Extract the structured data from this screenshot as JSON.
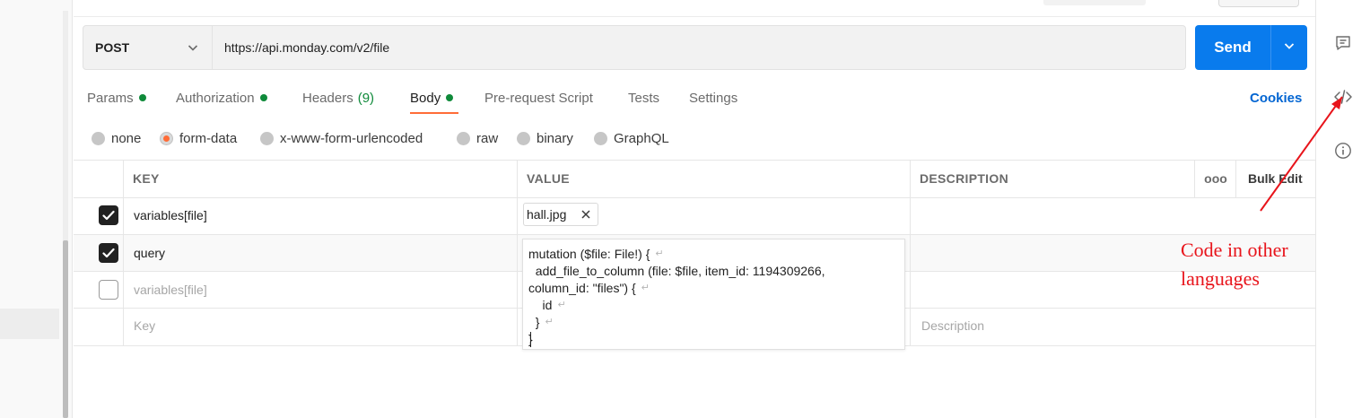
{
  "request": {
    "method": "POST",
    "url": "https://api.monday.com/v2/file",
    "send_label": "Send"
  },
  "tabs": [
    {
      "label": "Params",
      "dot": true
    },
    {
      "label": "Authorization",
      "dot": true
    },
    {
      "label": "Headers",
      "count": "(9)"
    },
    {
      "label": "Body",
      "dot": true,
      "active": true
    },
    {
      "label": "Pre-request Script"
    },
    {
      "label": "Tests"
    },
    {
      "label": "Settings"
    }
  ],
  "cookies_label": "Cookies",
  "body_types": [
    {
      "label": "none",
      "selected": false
    },
    {
      "label": "form-data",
      "selected": true
    },
    {
      "label": "x-www-form-urlencoded",
      "selected": false
    },
    {
      "label": "raw",
      "selected": false
    },
    {
      "label": "binary",
      "selected": false
    },
    {
      "label": "GraphQL",
      "selected": false
    }
  ],
  "table": {
    "headers": {
      "key": "KEY",
      "value": "VALUE",
      "description": "DESCRIPTION",
      "more": "ooo",
      "bulk_edit": "Bulk Edit"
    },
    "rows": [
      {
        "checked": true,
        "key": "variables[file]",
        "file": "hall.jpg"
      },
      {
        "checked": true,
        "key": "query"
      },
      {
        "checked": false,
        "key": "variables[file]"
      }
    ],
    "placeholder": {
      "key": "Key",
      "description": "Description"
    },
    "query_value_lines": [
      "mutation ($file: File!) {",
      "  add_file_to_column (file: $file, item_id: 1194309266,",
      "column_id: \"files\") {",
      "    id",
      "  }",
      "}"
    ],
    "newline_marker": "↵"
  },
  "annotation": {
    "line1": "Code in other",
    "line2": "languages",
    "color": "#e8141b"
  },
  "colors": {
    "send": "#097bed",
    "active_tab_underline": "#ff6c37",
    "status_dot": "#0f8a3a",
    "cookies_link": "#0265d2"
  }
}
